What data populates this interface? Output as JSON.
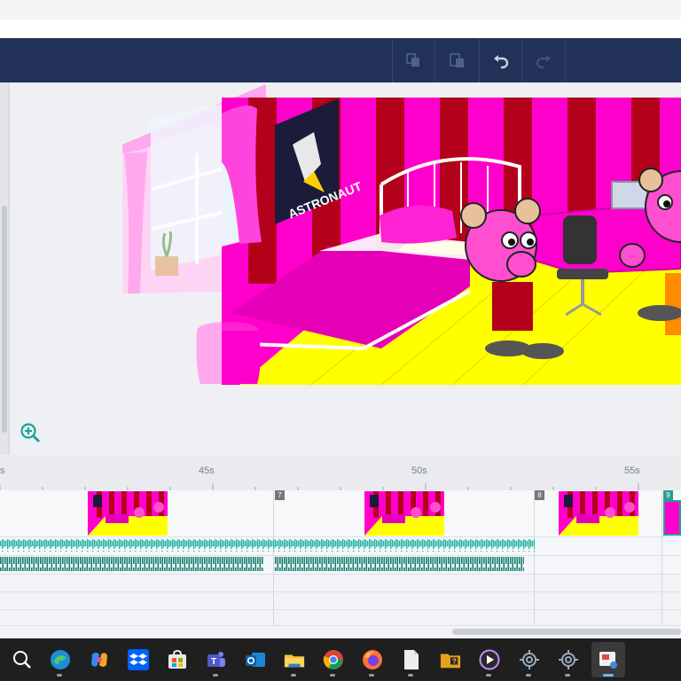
{
  "timeline": {
    "ticks": [
      "s",
      "45s",
      "50s",
      "55s"
    ],
    "scenes": [
      "7",
      "8",
      "9"
    ]
  },
  "stage": {
    "poster_text": "ASTRONAUT"
  },
  "colors": {
    "toolbar": "#223157",
    "wall_pink": "#ff00cc",
    "wall_red": "#b3001b",
    "floor_yellow": "#ffff00",
    "audio_wave": "#1fa79a"
  },
  "toolbar": {
    "icons": [
      "copy-icon",
      "paste-icon",
      "undo-icon",
      "redo-icon"
    ]
  },
  "taskbar": {
    "icons": [
      "search-icon",
      "edge-icon",
      "copilot-icon",
      "dropbox-icon",
      "store-icon",
      "teams-icon",
      "outlook-icon",
      "file-explorer-icon",
      "chrome-icon",
      "firefox-icon",
      "document-icon",
      "folder-app-icon",
      "media-player-icon",
      "settings-app-icon",
      "settings-app-2-icon",
      "video-editor-icon"
    ]
  }
}
